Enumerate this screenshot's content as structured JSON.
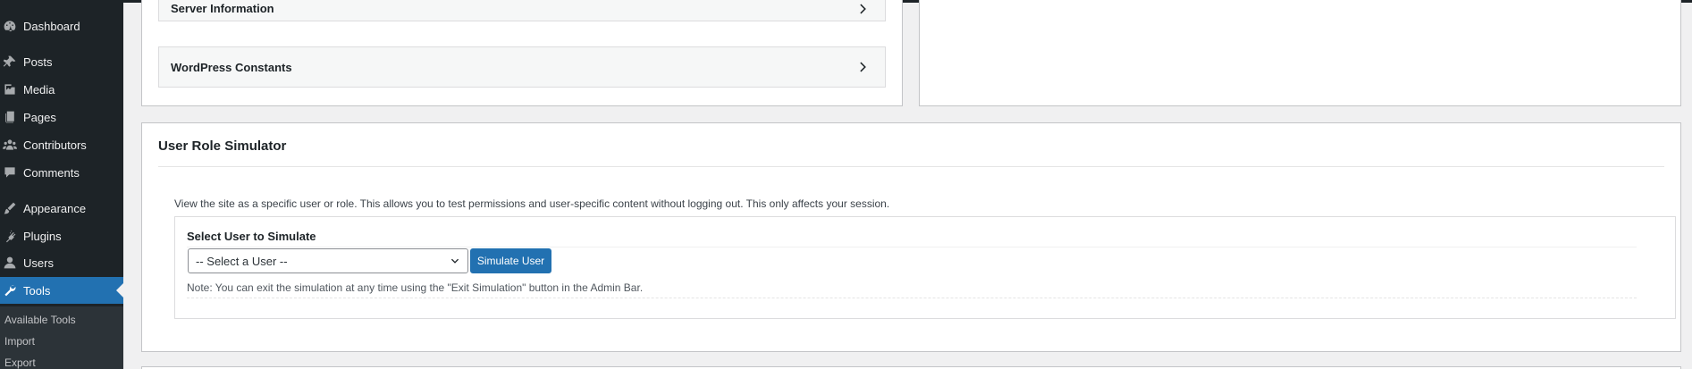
{
  "sidebar": {
    "items": [
      {
        "label": "Dashboard",
        "icon": "dashboard-icon"
      },
      {
        "label": "Posts",
        "icon": "pin-icon"
      },
      {
        "label": "Media",
        "icon": "media-icon"
      },
      {
        "label": "Pages",
        "icon": "pages-icon"
      },
      {
        "label": "Contributors",
        "icon": "groups-icon"
      },
      {
        "label": "Comments",
        "icon": "comment-icon"
      },
      {
        "label": "Appearance",
        "icon": "brush-icon"
      },
      {
        "label": "Plugins",
        "icon": "plugin-icon"
      },
      {
        "label": "Users",
        "icon": "user-icon"
      },
      {
        "label": "Tools",
        "icon": "wrench-icon",
        "active": true
      }
    ],
    "submenu": [
      "Available Tools",
      "Import",
      "Export"
    ]
  },
  "accordions": {
    "server_info": "Server Information",
    "constants": "WordPress Constants"
  },
  "simulator": {
    "title": "User Role Simulator",
    "description": "View the site as a specific user or role. This allows you to test permissions and user-specific content without logging out. This only affects your session.",
    "select_label": "Select User to Simulate",
    "select_value": "-- Select a User --",
    "button_label": "Simulate User",
    "note": "Note: You can exit the simulation at any time using the \"Exit Simulation\" button in the Admin Bar."
  },
  "colors": {
    "sidebar_bg": "#1d2327",
    "accent": "#2271b1",
    "page_bg": "#f0f0f1"
  }
}
